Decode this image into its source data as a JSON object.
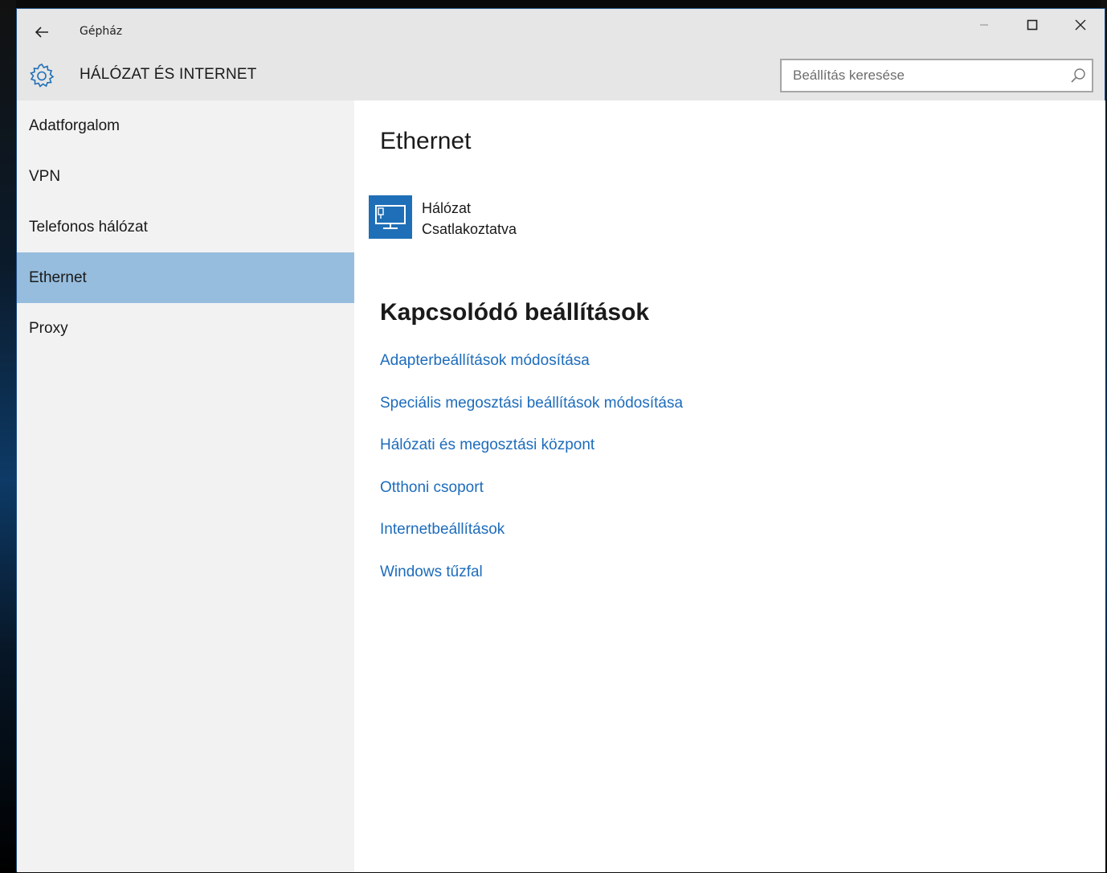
{
  "window": {
    "app_title": "Gépház",
    "section_title": "HÁLÓZAT ÉS INTERNET",
    "controls": {
      "minimize": "—",
      "maximize": "☐",
      "close": "✕"
    },
    "back_icon": "back-arrow-icon"
  },
  "search": {
    "placeholder": "Beállítás keresése",
    "value": ""
  },
  "sidebar": {
    "items": [
      {
        "label": "Adatforgalom",
        "selected": false
      },
      {
        "label": "VPN",
        "selected": false
      },
      {
        "label": "Telefonos hálózat",
        "selected": false
      },
      {
        "label": "Ethernet",
        "selected": true
      },
      {
        "label": "Proxy",
        "selected": false
      }
    ]
  },
  "main": {
    "title": "Ethernet",
    "network": {
      "name": "Hálózat",
      "status": "Csatlakoztatva",
      "icon": "ethernet-monitor-icon"
    },
    "related_title": "Kapcsolódó beállítások",
    "links": [
      "Adapterbeállítások módosítása",
      "Speciális megosztási beállítások módosítása",
      "Hálózati és megosztási központ",
      "Otthoni csoport",
      "Internetbeállítások",
      "Windows tűzfal"
    ]
  },
  "colors": {
    "accent": "#1e6fb7",
    "link": "#1d6cbc",
    "selected_nav": "#96bddd",
    "sidebar_bg": "#f2f2f2",
    "titlebar_bg": "#e6e6e6"
  }
}
